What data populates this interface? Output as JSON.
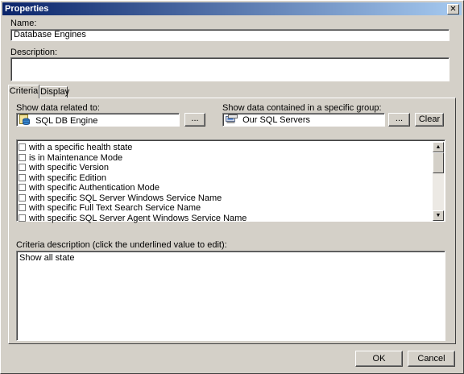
{
  "window": {
    "title": "Properties",
    "close_glyph": "✕"
  },
  "name": {
    "label": "Name:",
    "value": "Database Engines"
  },
  "description": {
    "label": "Description:",
    "value": ""
  },
  "tabs": [
    {
      "label": "Criteria"
    },
    {
      "label": "Display"
    }
  ],
  "criteria": {
    "related_label": "Show data related to:",
    "related_value": "SQL DB Engine",
    "related_icon": "sql-db-engine-icon",
    "related_browse": "...",
    "group_label": "Show data contained in a specific group:",
    "group_value": "Our SQL Servers",
    "group_icon": "computer-group-icon",
    "group_browse": "...",
    "clear_label": "Clear",
    "conditions": [
      {
        "label": "with a specific health state",
        "checked": false
      },
      {
        "label": "is in Maintenance Mode",
        "checked": false
      },
      {
        "label": "with specific Version",
        "checked": false
      },
      {
        "label": "with specific Edition",
        "checked": false
      },
      {
        "label": "with specific Authentication Mode",
        "checked": false
      },
      {
        "label": "with specific SQL Server Windows Service Name",
        "checked": false
      },
      {
        "label": "with specific Full Text Search Service Name",
        "checked": false
      },
      {
        "label": "with specific SQL Server Agent Windows Service Name",
        "checked": false
      }
    ],
    "scroll_up_glyph": "▲",
    "scroll_down_glyph": "▼",
    "description_label": "Criteria description (click the underlined value to edit):",
    "description_value": "Show all state"
  },
  "footer": {
    "ok_label": "OK",
    "cancel_label": "Cancel"
  }
}
